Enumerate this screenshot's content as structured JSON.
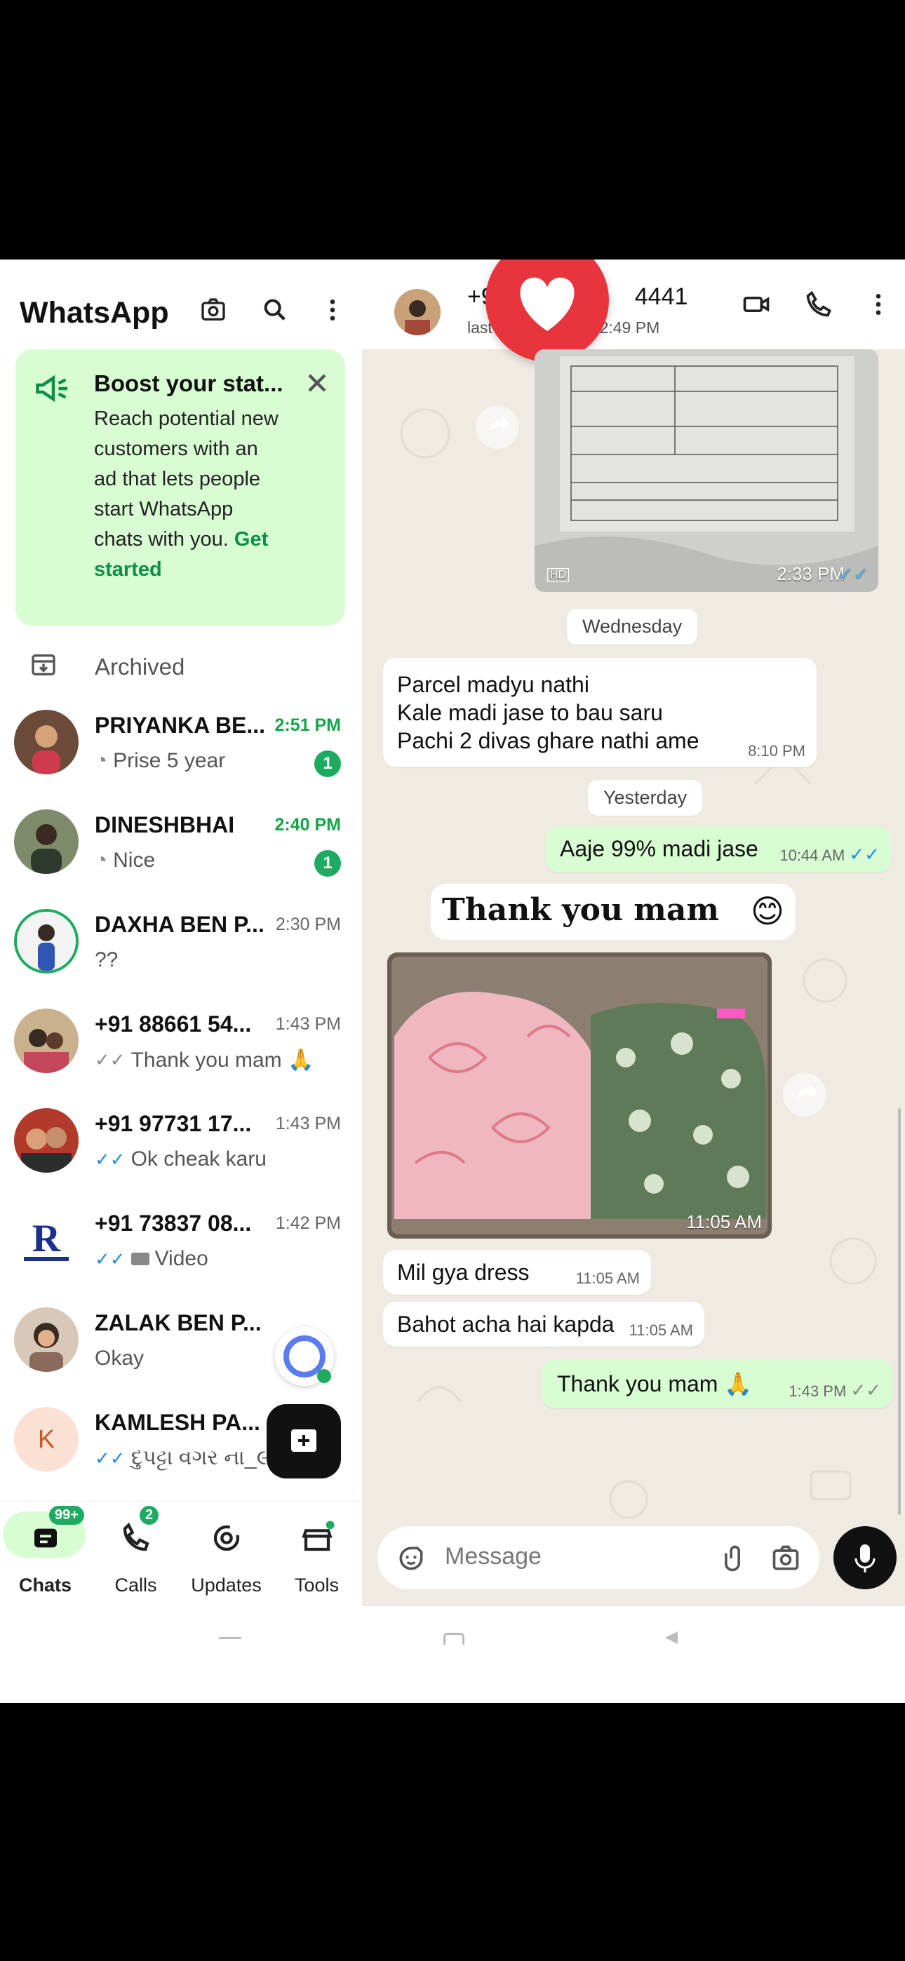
{
  "app": {
    "title": "WhatsApp"
  },
  "boost": {
    "title": "Boost your stat...",
    "body": "Reach potential new customers with an ad that lets people start WhatsApp chats with you.",
    "link": "Get started"
  },
  "archived": {
    "label": "Archived"
  },
  "chats": [
    {
      "name": "PRIYANKA BE...",
      "time": "2:51 PM",
      "preview": "Prise 5 year",
      "unread": "1",
      "time_green": true,
      "prefix": "status"
    },
    {
      "name": "DINESHBHAI",
      "time": "2:40 PM",
      "preview": "Nice",
      "unread": "1",
      "time_green": true,
      "prefix": "status"
    },
    {
      "name": "DAXHA BEN P...",
      "time": "2:30 PM",
      "preview": "??",
      "unread": "",
      "time_green": false,
      "prefix": ""
    },
    {
      "name": "+91 88661 54...",
      "time": "1:43 PM",
      "preview": "Thank you mam 🙏",
      "unread": "",
      "time_green": false,
      "prefix": "grey-tick"
    },
    {
      "name": "+91 97731 17...",
      "time": "1:43 PM",
      "preview": "Ok cheak karu",
      "unread": "",
      "time_green": false,
      "prefix": "blue-tick"
    },
    {
      "name": "+91 73837 08...",
      "time": "1:42 PM",
      "preview": "Video",
      "unread": "",
      "time_green": false,
      "prefix": "blue-tick-video"
    },
    {
      "name": "ZALAK BEN P...",
      "time": "1:__ PM",
      "preview": "Okay",
      "unread": "",
      "time_green": false,
      "prefix": ""
    },
    {
      "name": "KAMLESH PA...",
      "time": "",
      "preview": "દુપટ્ટા વગર ના_૯૦",
      "unread": "",
      "time_green": false,
      "prefix": "blue-tick",
      "initial": "K"
    }
  ],
  "nav": {
    "chats": "Chats",
    "chats_badge": "99+",
    "calls": "Calls",
    "calls_badge": "2",
    "updates": "Updates",
    "tools": "Tools"
  },
  "conversation": {
    "contact": "+9",
    "contact_end": "4441",
    "last_seen_a": "last",
    "last_seen_b": "12:49 PM",
    "image1_time": "2:33 PM",
    "image1_hd": "HD",
    "date1": "Wednesday",
    "msg1_lines": [
      "Parcel madyu nathi",
      "Kale madi jase to bau saru",
      "Pachi 2 divas ghare nathi ame"
    ],
    "msg1_time": "8:10 PM",
    "date2": "Yesterday",
    "msg2": "Aaje 99% madi jase",
    "msg2_time": "10:44 AM",
    "sticker": "Thank you mam",
    "sticker_emoji": "😊",
    "image2_time": "11:05 AM",
    "msg3": "Mil gya dress",
    "msg3_time": "11:05 AM",
    "msg4": "Bahot acha hai kapda",
    "msg4_time": "11:05 AM",
    "msg5": "Thank you mam 🙏",
    "msg5_time": "1:43 PM",
    "input_placeholder": "Message"
  },
  "colors": {
    "accent": "#1dab61",
    "out_bubble": "#d9fdd3",
    "chat_bg": "#efeae2",
    "heart": "#e8343c"
  }
}
